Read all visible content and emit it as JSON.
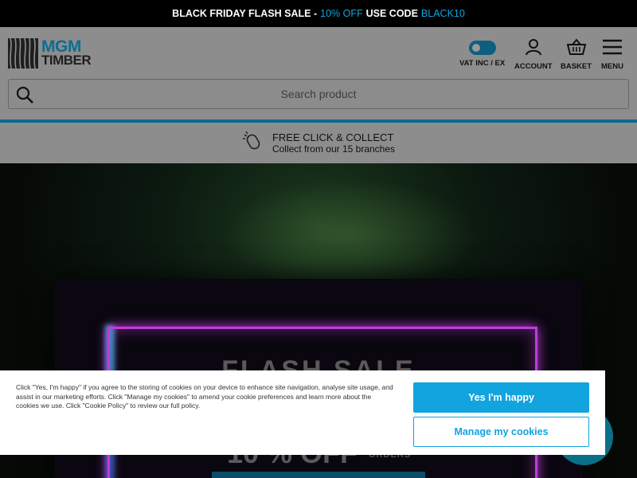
{
  "promo": {
    "part1": "BLACK FRIDAY FLASH SALE -",
    "part2": "10% OFF",
    "part3": "USE CODE",
    "part4": "BLACK10"
  },
  "logo": {
    "line1": "MGM",
    "line2": "TIMBER"
  },
  "header": {
    "vat_label": "VAT INC / EX",
    "account_label": "ACCOUNT",
    "basket_label": "BASKET",
    "menu_label": "MENU"
  },
  "search": {
    "placeholder": "Search product"
  },
  "collect": {
    "title": "FREE CLICK & COLLECT",
    "subtitle": "Collect from our 15 branches"
  },
  "hero": {
    "headline": "FLASH SALE",
    "discount": "10 % OFF",
    "orders": "ORDERS"
  },
  "cookie": {
    "message": "Click \"Yes, I'm happy\" if you agree to the storing of cookies on your device to enhance site navigation, analyse site usage, and assist in our marketing efforts. Click \"Manage my cookies\" to amend your cookie preferences and learn more about the cookies we use. Click \"Cookie Policy\" to review our full policy.",
    "accept_label": "Yes I'm happy",
    "manage_label": "Manage my cookies"
  },
  "colors": {
    "accent": "#11a4df",
    "brand_dark": "#0e6d93",
    "promo_bg": "#000000"
  },
  "icons": {
    "account": "user-icon",
    "basket": "basket-icon",
    "menu": "hamburger-icon",
    "search": "search-icon",
    "collect": "mouse-click-icon",
    "vat": "toggle-switch",
    "chat": "chat-bubble-icon"
  }
}
